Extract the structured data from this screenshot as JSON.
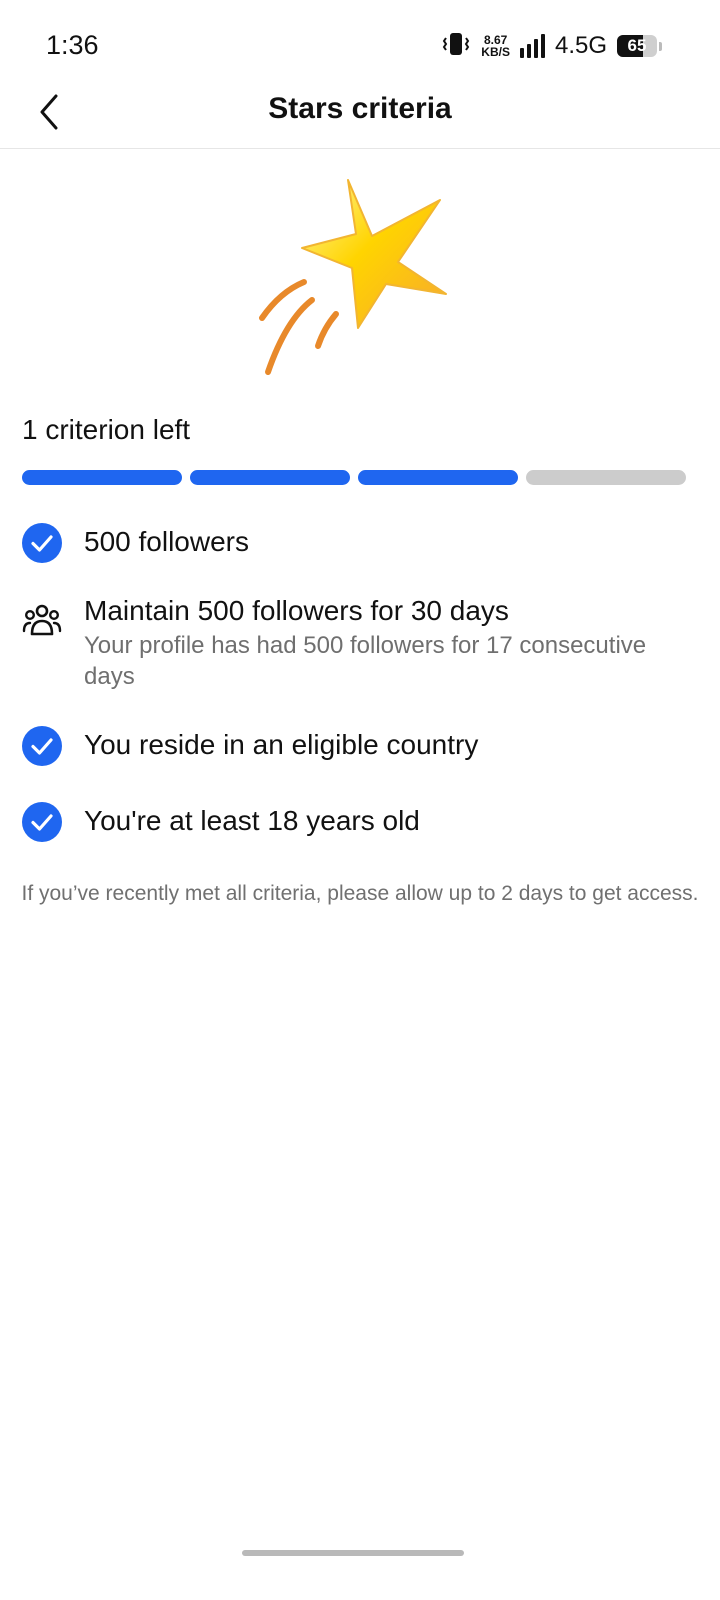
{
  "status_bar": {
    "time": "1:36",
    "net_speed_value": "8.67",
    "net_speed_unit": "KB/S",
    "network_type": "4.5G",
    "battery_level": "65",
    "icons": [
      "vibrate-icon",
      "signal-icon",
      "battery-icon"
    ]
  },
  "header": {
    "title": "Stars criteria",
    "back_icon": "chevron-left-icon"
  },
  "hero": {
    "icon": "shooting-star-icon",
    "colors": [
      "#ffd400",
      "#f7a830",
      "#e8892a"
    ]
  },
  "progress": {
    "label": "1 criterion left",
    "total_segments": 4,
    "completed_segments": 3,
    "color_done": "#1f66f0",
    "color_pending": "#cccccc"
  },
  "criteria": [
    {
      "title": "500 followers",
      "detail": "",
      "status": "met",
      "icon": "check-circle-icon"
    },
    {
      "title": "Maintain 500 followers for 30 days",
      "detail": "Your profile has had 500 followers for 17 consecutive days",
      "status": "pending",
      "icon": "people-icon"
    },
    {
      "title": "You reside in an eligible country",
      "detail": "",
      "status": "met",
      "icon": "check-circle-icon"
    },
    {
      "title": "You're at least 18 years old",
      "detail": "",
      "status": "met",
      "icon": "check-circle-icon"
    }
  ],
  "footer_note": "If you’ve recently met all criteria, please allow up to 2 days to get access.",
  "accent_color": "#1f66f0"
}
